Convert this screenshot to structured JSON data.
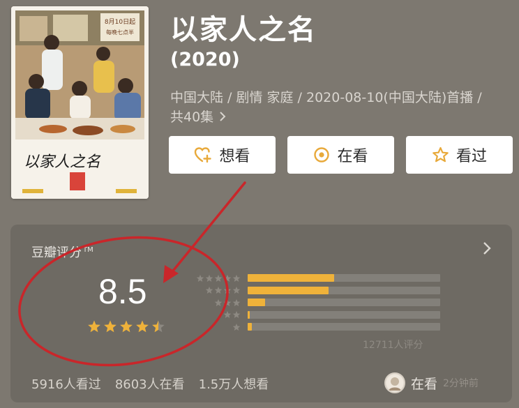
{
  "poster": {
    "date_tag_line1": "8月10日起",
    "date_tag_line2": "每晚七点半",
    "calligraphy": "以家人之名"
  },
  "show": {
    "title": "以家人之名",
    "year": "(2020)",
    "meta_line1": "中国大陆 / 剧情 家庭 / 2020-08-10(中国大陆)首播 /",
    "meta_line2": "共40集",
    "meta_chevron_icon": "chevron-right-icon"
  },
  "actions": [
    {
      "label": "想看",
      "icon": "heart-plus-icon"
    },
    {
      "label": "在看",
      "icon": "target-circle-icon"
    },
    {
      "label": "看过",
      "icon": "star-outline-icon"
    }
  ],
  "rating": {
    "label": "豆瓣评分",
    "tm": "TM",
    "score": "8.5",
    "stars_value": 4.5,
    "stars_max": 5,
    "distribution": [
      {
        "stars": 5,
        "fraction": 0.45
      },
      {
        "stars": 4,
        "fraction": 0.42
      },
      {
        "stars": 3,
        "fraction": 0.09
      },
      {
        "stars": 2,
        "fraction": 0.01
      },
      {
        "stars": 1,
        "fraction": 0.02
      }
    ],
    "count_text": "12711人评分",
    "stats": [
      "5916人看过",
      "8603人在看",
      "1.5万人想看"
    ],
    "status_label": "在看",
    "status_time": "2分钟前"
  },
  "colors": {
    "accent_star": "#efb23a",
    "annotation_red": "#c9262a",
    "background": "#7d7870",
    "card": "#6e6a63"
  }
}
